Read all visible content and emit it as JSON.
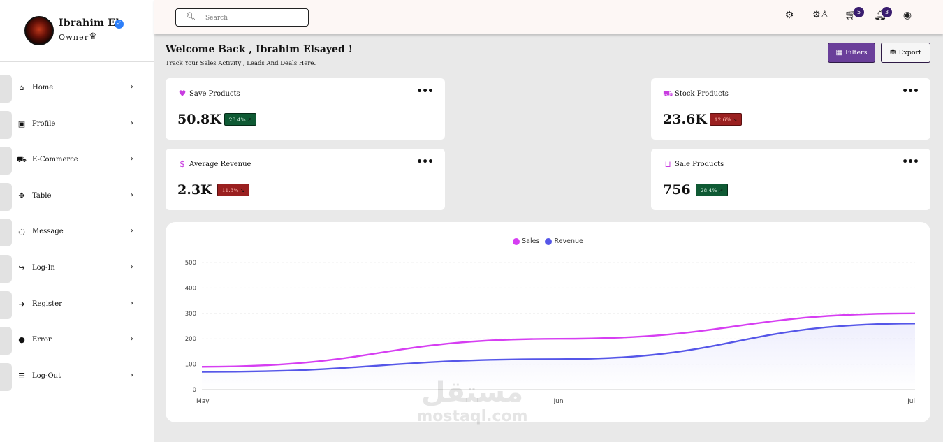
{
  "user": {
    "name": "Ibrahim El",
    "role": "Owner"
  },
  "sidebar": {
    "items": [
      {
        "label": "Home",
        "icon": "home-icon",
        "glyph": "⌂"
      },
      {
        "label": "Profile",
        "icon": "profile-card-icon",
        "glyph": "▣"
      },
      {
        "label": "E-Commerce",
        "icon": "cart-icon",
        "glyph": "⛟"
      },
      {
        "label": "Table",
        "icon": "table-icon",
        "glyph": "✥"
      },
      {
        "label": "Message",
        "icon": "message-icon",
        "glyph": "◌"
      },
      {
        "label": "Log-In",
        "icon": "login-icon",
        "glyph": "↪"
      },
      {
        "label": "Register",
        "icon": "register-icon",
        "glyph": "➔"
      },
      {
        "label": "Error",
        "icon": "error-bomb-icon",
        "glyph": "●"
      },
      {
        "label": "Log-Out",
        "icon": "logout-icon",
        "glyph": "☰"
      }
    ]
  },
  "search": {
    "placeholder": "Search"
  },
  "topbar": {
    "icons": [
      "gear-icon",
      "users-gear-icon",
      "cart-icon",
      "bell-icon",
      "user-circle-icon"
    ],
    "cart_count": "5",
    "notification_count": "3"
  },
  "header": {
    "welcome": "Welcome Back , Ibrahim Elsayed !",
    "subtitle": "Track Your Sales Activity , Leads And Deals Here.",
    "filters_label": "Filters",
    "export_label": "Export"
  },
  "cards": [
    {
      "title": "Save Products",
      "value": "50.8K",
      "change": "28.4%",
      "trend": "up",
      "icon": "heart-icon",
      "glyph": "♥"
    },
    {
      "title": "Stock Products",
      "value": "23.6K",
      "change": "12.6%",
      "trend": "down",
      "icon": "cart-icon",
      "glyph": "⛟"
    },
    {
      "title": "Average Revenue",
      "value": "2.3K",
      "change": "11.3%",
      "trend": "down",
      "icon": "dollar-icon",
      "glyph": "$"
    },
    {
      "title": "Sale Products",
      "value": "756",
      "change": "28.4%",
      "trend": "up",
      "icon": "inbox-icon",
      "glyph": "⊔"
    }
  ],
  "colors": {
    "accent": "#6a3f9a",
    "sales": "#d63ef2",
    "revenue": "#5556e8",
    "badge_up": "#0f5a34",
    "badge_down": "#9a2020"
  },
  "watermark": {
    "arabic": "مستقل",
    "latin": "mostaql.com"
  },
  "chart_data": {
    "type": "line",
    "categories": [
      "May",
      "Jun",
      "Jul"
    ],
    "x": [
      0,
      0.5,
      1
    ],
    "series": [
      {
        "name": "Sales",
        "color": "#d63ef2",
        "values": [
          90,
          200,
          300
        ]
      },
      {
        "name": "Revenue",
        "color": "#5556e8",
        "values": [
          70,
          120,
          260
        ]
      }
    ],
    "ylim": [
      0,
      500
    ],
    "yticks": [
      0,
      100,
      200,
      300,
      400,
      500
    ],
    "legend": "top-center",
    "grid": true,
    "curve": "smooth"
  }
}
